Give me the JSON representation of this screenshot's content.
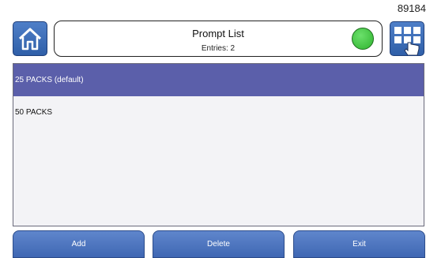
{
  "device_id": "89184",
  "header": {
    "title": "Prompt List",
    "entries": "Entries: 2",
    "status_color": "#3cc43c"
  },
  "icons": {
    "home": "home-icon",
    "menu": "grid-menu-icon",
    "status": "status-indicator-icon"
  },
  "list": {
    "items": [
      {
        "label": "25 PACKS (default)",
        "selected": true
      },
      {
        "label": "50 PACKS",
        "selected": false
      }
    ]
  },
  "footer": {
    "add_label": "Add",
    "delete_label": "Delete",
    "exit_label": "Exit"
  },
  "colors": {
    "accent": "#3f67b3",
    "selection": "#5b5faa"
  }
}
